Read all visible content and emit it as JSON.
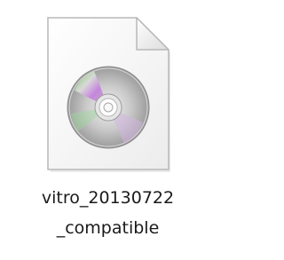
{
  "file": {
    "icon": "disc-image-file-icon",
    "name_line_1": "vitro_20130722",
    "name_line_2": "_compatible"
  },
  "colors": {
    "background": "#ffffff",
    "page": "#f4f4f4",
    "page_border": "#b8b8b8",
    "disc": "#bdbdbd",
    "text": "#1a1a1a"
  }
}
